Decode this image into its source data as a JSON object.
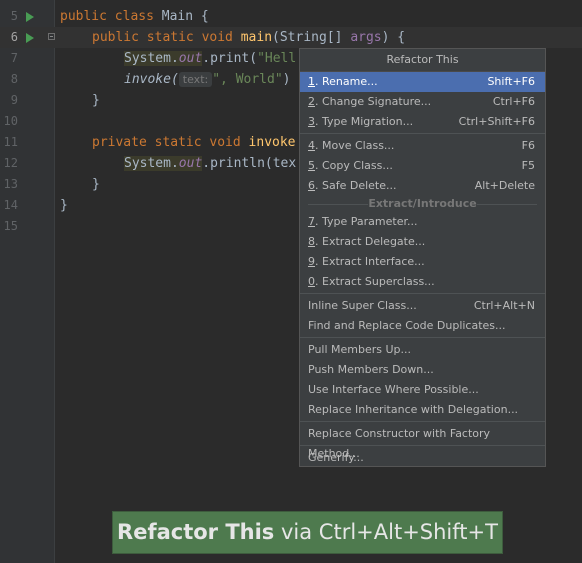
{
  "editor": {
    "lines": [
      {
        "num": "5"
      },
      {
        "num": "6"
      },
      {
        "num": "7"
      },
      {
        "num": "8"
      },
      {
        "num": "9"
      },
      {
        "num": "10"
      },
      {
        "num": "11"
      },
      {
        "num": "12"
      },
      {
        "num": "13"
      },
      {
        "num": "14"
      },
      {
        "num": "15"
      }
    ],
    "code": {
      "l5_kw": "public class ",
      "l5_name": "Main {",
      "l6_kw": "public static void ",
      "l6_fn": "main",
      "l6_params": "(String[] ",
      "l6_arg": "args",
      "l6_end": ") {",
      "l7_sys": "System.",
      "l7_out": "out",
      "l7_call": ".print(",
      "l7_str": "\"Hell",
      "l8_invoke": "invoke(",
      "l8_hint": "text:",
      "l8_str": "\", World\"",
      "l8_end": ")",
      "l9": "}",
      "l11_kw": "private static void ",
      "l11_fn": "invoke",
      "l12_sys": "System.",
      "l12_out": "out",
      "l12_call": ".println(tex",
      "l13": "}",
      "l14": "}"
    }
  },
  "menu": {
    "title": "Refactor This",
    "items": [
      {
        "mnemonic": "1",
        "label": ". Rename...",
        "shortcut": "Shift+F6",
        "selected": true
      },
      {
        "mnemonic": "2",
        "label": ". Change Signature...",
        "shortcut": "Ctrl+F6"
      },
      {
        "mnemonic": "3",
        "label": ". Type Migration...",
        "shortcut": "Ctrl+Shift+F6"
      },
      {
        "mnemonic": "4",
        "label": ". Move Class...",
        "shortcut": "F6"
      },
      {
        "mnemonic": "5",
        "label": ". Copy Class...",
        "shortcut": "F5"
      },
      {
        "mnemonic": "6",
        "label": ". Safe Delete...",
        "shortcut": "Alt+Delete"
      },
      {
        "mnemonic": "7",
        "label": ". Type Parameter...",
        "shortcut": ""
      },
      {
        "mnemonic": "8",
        "label": ". Extract Delegate...",
        "shortcut": ""
      },
      {
        "mnemonic": "9",
        "label": ". Extract Interface...",
        "shortcut": ""
      },
      {
        "mnemonic": "0",
        "label": ". Extract Superclass...",
        "shortcut": ""
      },
      {
        "mnemonic": "",
        "label": "Inline Super Class...",
        "shortcut": "Ctrl+Alt+N"
      },
      {
        "mnemonic": "",
        "label": "Find and Replace Code Duplicates...",
        "shortcut": ""
      },
      {
        "mnemonic": "",
        "label": "Pull Members Up...",
        "shortcut": ""
      },
      {
        "mnemonic": "",
        "label": "Push Members Down...",
        "shortcut": ""
      },
      {
        "mnemonic": "",
        "label": "Use Interface Where Possible...",
        "shortcut": ""
      },
      {
        "mnemonic": "",
        "label": "Replace Inheritance with Delegation...",
        "shortcut": ""
      },
      {
        "mnemonic": "",
        "label": "Replace Constructor with Factory Method...",
        "shortcut": ""
      },
      {
        "mnemonic": "",
        "label": "Generify...",
        "shortcut": ""
      }
    ],
    "group_extract": "Extract/Introduce"
  },
  "banner": {
    "action": "Refactor This",
    "via": " via Ctrl+Alt+Shift+T"
  },
  "colors": {
    "background": "#2b2b2b",
    "menu_selected": "#4b6eaf",
    "banner": "#4e7a4e"
  }
}
